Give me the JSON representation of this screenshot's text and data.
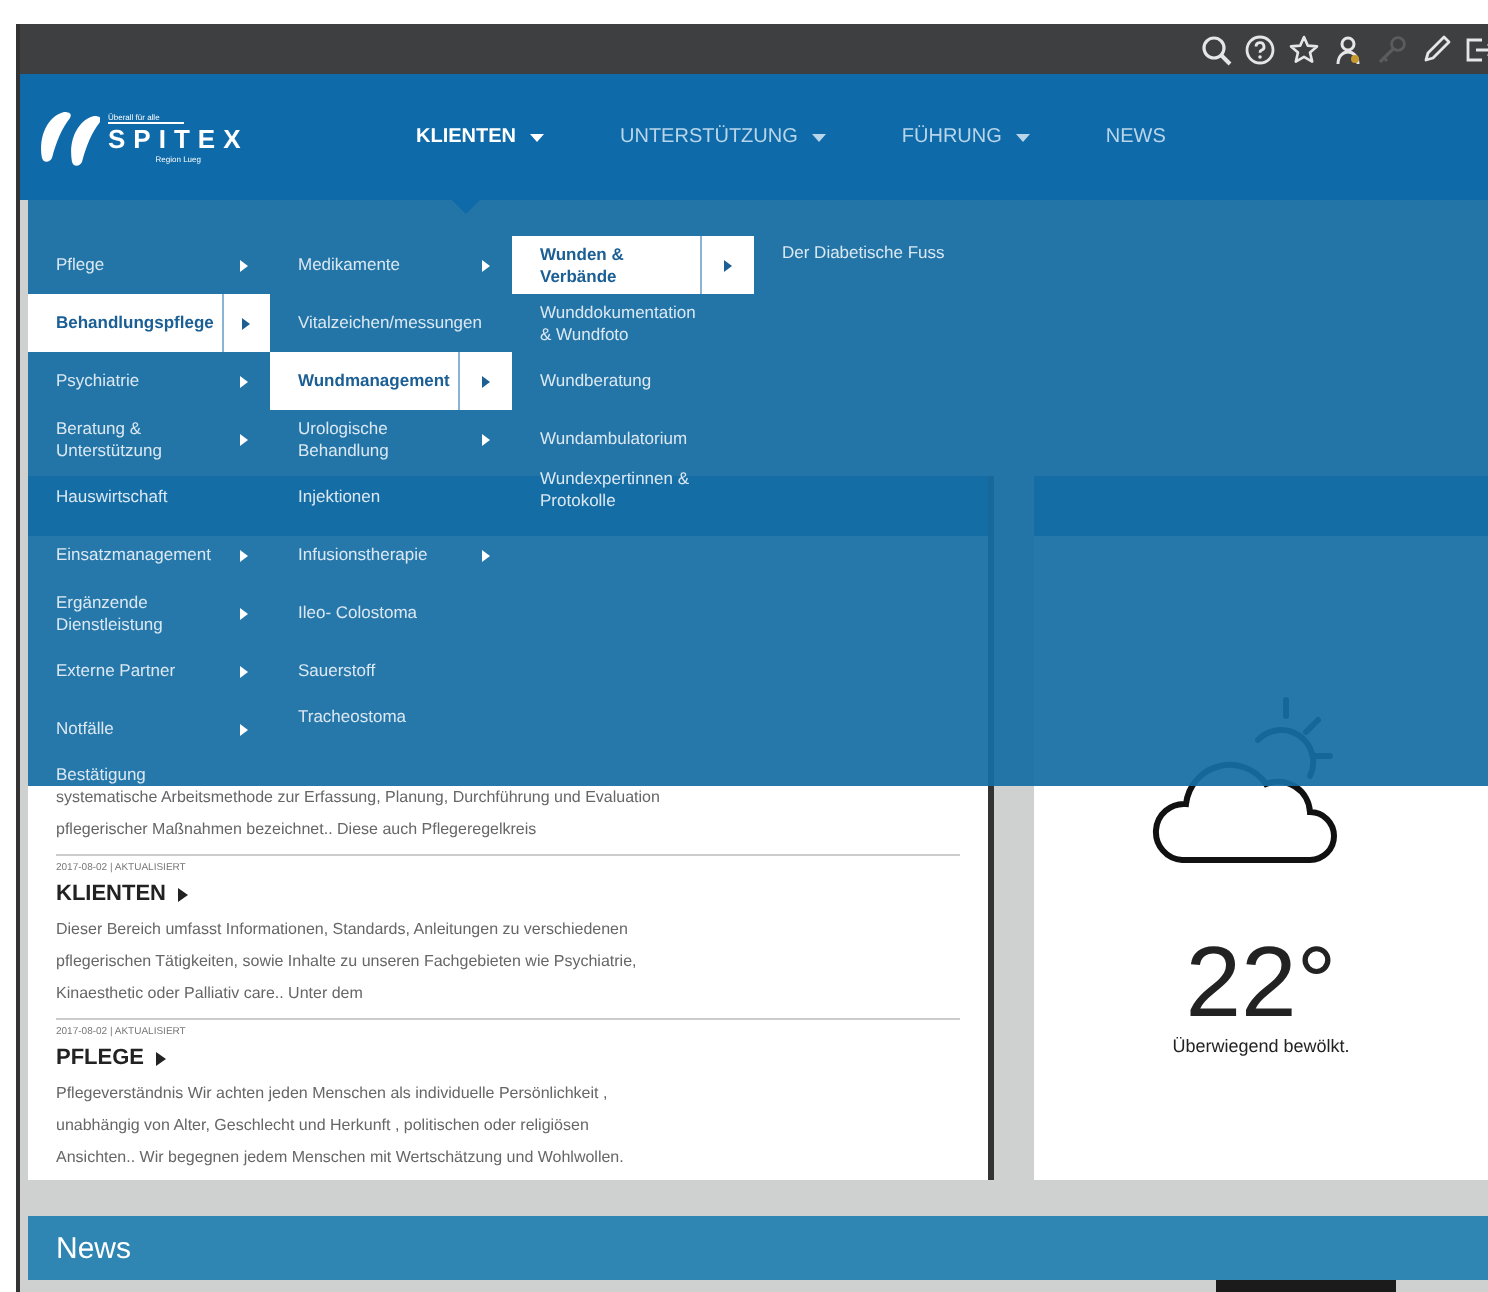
{
  "topbar": {
    "icons": [
      {
        "kind": "search",
        "disabled": false
      },
      {
        "kind": "help",
        "disabled": false
      },
      {
        "kind": "star",
        "disabled": false
      },
      {
        "kind": "user",
        "disabled": false
      },
      {
        "kind": "key",
        "disabled": true
      },
      {
        "kind": "pencil",
        "disabled": false
      },
      {
        "kind": "logout",
        "disabled": false
      }
    ]
  },
  "header": {
    "logo": {
      "tagline": "Überall für alle",
      "name": "SPITEX",
      "region": "Region Lueg"
    },
    "nav": [
      {
        "label": "KLIENTEN",
        "selected": true,
        "has_menu": true
      },
      {
        "label": "UNTERSTÜTZUNG",
        "selected": false,
        "has_menu": true
      },
      {
        "label": "FÜHRUNG",
        "selected": false,
        "has_menu": true
      },
      {
        "label": "NEWS",
        "selected": false,
        "has_menu": false
      }
    ]
  },
  "mega_menu": {
    "columns": [
      {
        "items": [
          {
            "label": "Pflege",
            "has_children": true,
            "selected": false
          },
          {
            "label": "Behandlungspflege",
            "has_children": true,
            "selected": true
          },
          {
            "label": "Psychiatrie",
            "has_children": true,
            "selected": false
          },
          {
            "label": "Beratung & Unterstützung",
            "has_children": true,
            "selected": false
          },
          {
            "label": "Hauswirtschaft",
            "has_children": false,
            "selected": false
          },
          {
            "label": "Einsatzmanagement",
            "has_children": true,
            "selected": false
          },
          {
            "label": "Ergänzende Dienstleistung",
            "has_children": true,
            "selected": false
          },
          {
            "label": "Externe Partner",
            "has_children": true,
            "selected": false
          },
          {
            "label": "Notfälle",
            "has_children": true,
            "selected": false
          },
          {
            "label": "Bestätigung",
            "has_children": false,
            "selected": false
          }
        ]
      },
      {
        "items": [
          {
            "label": "Medikamente",
            "has_children": true,
            "selected": false
          },
          {
            "label": "Vitalzeichen/messungen",
            "has_children": false,
            "selected": false
          },
          {
            "label": "Wundmanagement",
            "has_children": true,
            "selected": true
          },
          {
            "label": "Urologische Behandlung",
            "has_children": true,
            "selected": false
          },
          {
            "label": "Injektionen",
            "has_children": false,
            "selected": false
          },
          {
            "label": "Infusionstherapie",
            "has_children": true,
            "selected": false
          },
          {
            "label": "Ileo- Colostoma",
            "has_children": false,
            "selected": false
          },
          {
            "label": "Sauerstoff",
            "has_children": false,
            "selected": false
          },
          {
            "label": "Tracheostoma",
            "has_children": false,
            "selected": false
          }
        ]
      },
      {
        "items": [
          {
            "label": "Wunden & Verbände",
            "has_children": true,
            "selected": true
          },
          {
            "label": "Wunddokumentation & Wundfoto",
            "has_children": false,
            "selected": false
          },
          {
            "label": "Wundberatung",
            "has_children": false,
            "selected": false
          },
          {
            "label": "Wundambulatorium",
            "has_children": false,
            "selected": false
          },
          {
            "label": "Wundexpertinnen & Protokolle",
            "has_children": false,
            "selected": false
          }
        ]
      },
      {
        "items": [
          {
            "label": "Der Diabetische Fuss",
            "has_children": false,
            "selected": false
          }
        ]
      }
    ]
  },
  "articles": [
    {
      "body": "systematische Arbeitsmethode zur Erfassung, Planung, Durchführung und Evaluation pflegerischer Maßnahmen bezeichnet.. Diese auch Pflegeregelkreis"
    },
    {
      "date": "2017-08-02 | AKTUALISIERT",
      "title": "KLIENTEN",
      "body": "Dieser Bereich umfasst Informationen, Standards, Anleitungen zu verschiedenen pflegerischen Tätigkeiten, sowie Inhalte zu unseren Fachgebieten wie Psychiatrie, Kinaesthetic oder Palliativ care.. Unter dem"
    },
    {
      "date": "2017-08-02 | AKTUALISIERT",
      "title": "PFLEGE",
      "body": "Pflegeverständnis Wir achten jeden Menschen als individuelle Persönlichkeit , unabhängig von Alter, Geschlecht und Herkunft , politischen oder religiösen Ansichten.. Wir begegnen jedem Menschen mit Wertschätzung und Wohlwollen."
    }
  ],
  "weather": {
    "temperature": "22°",
    "description": "Überwiegend bewölkt."
  },
  "news": {
    "title": "News"
  }
}
